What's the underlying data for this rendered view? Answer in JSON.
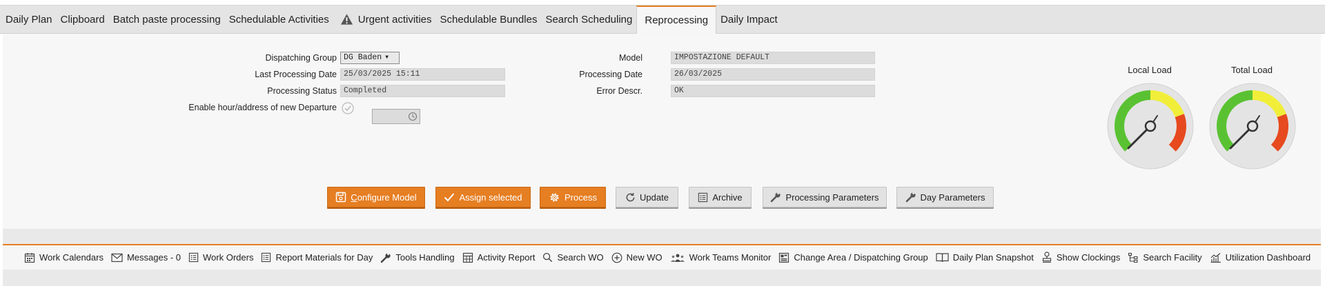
{
  "tabs": [
    {
      "label": "Daily Plan",
      "active": false
    },
    {
      "label": "Clipboard",
      "active": false
    },
    {
      "label": "Batch paste processing",
      "active": false
    },
    {
      "label": "Schedulable Activities",
      "active": false
    },
    {
      "label": "Urgent activities",
      "active": false,
      "icon": "warning-icon"
    },
    {
      "label": "Schedulable Bundles",
      "active": false
    },
    {
      "label": "Search Scheduling",
      "active": false
    },
    {
      "label": "Reprocessing",
      "active": true
    },
    {
      "label": "Daily Impact",
      "active": false
    }
  ],
  "form": {
    "dispatching_group_label": "Dispatching Group",
    "dispatching_group_value": "DG Baden",
    "last_processing_date_label": "Last Processing Date",
    "last_processing_date_value": "25/03/2025 15:11",
    "processing_status_label": "Processing Status",
    "processing_status_value": "Completed",
    "enable_hour_label": "Enable hour/address of new Departure",
    "model_label": "Model",
    "model_value": "IMPOSTAZIONE DEFAULT",
    "processing_date_label": "Processing Date",
    "processing_date_value": "26/03/2025",
    "error_descr_label": "Error Descr.",
    "error_descr_value": "OK"
  },
  "gauges": {
    "local": {
      "label": "Local Load"
    },
    "total": {
      "label": "Total Load"
    }
  },
  "buttons": {
    "configure_model": "Configure Model",
    "configure_model_first": "C",
    "configure_model_rest": "onfigure Model",
    "assign_selected": "Assign selected",
    "process": "Process",
    "update": "Update",
    "archive": "Archive",
    "processing_parameters": "Processing Parameters",
    "day_parameters": "Day Parameters"
  },
  "toolbar": [
    {
      "label": "Work Calendars",
      "icon": "calendar-icon"
    },
    {
      "label": "Messages - 0",
      "icon": "envelope-icon"
    },
    {
      "label": "Work Orders",
      "icon": "list-icon"
    },
    {
      "label": "Report Materials for Day",
      "icon": "list-icon"
    },
    {
      "label": "Tools Handling",
      "icon": "wrench-icon"
    },
    {
      "label": "Activity Report",
      "icon": "table-icon"
    },
    {
      "label": "Search WO",
      "icon": "search-icon"
    },
    {
      "label": "New WO",
      "icon": "plus-circle-icon"
    },
    {
      "label": "Work Teams Monitor",
      "icon": "team-icon"
    },
    {
      "label": "Change Area / Dispatching Group",
      "icon": "area-icon"
    },
    {
      "label": "Daily Plan Snapshot",
      "icon": "book-icon"
    },
    {
      "label": "Show Clockings",
      "icon": "stamp-icon"
    },
    {
      "label": "Search Facility",
      "icon": "hierarchy-icon"
    },
    {
      "label": "Utilization Dashboard",
      "icon": "chart-icon"
    }
  ],
  "colors": {
    "accent": "#e67e22",
    "gauge_green": "#5ac232",
    "gauge_yellow": "#f1ee3a",
    "gauge_red": "#e64a1e"
  }
}
